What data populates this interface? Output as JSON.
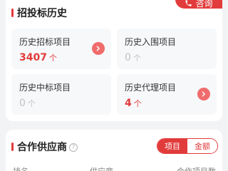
{
  "colors": {
    "accent": "#e23b3b",
    "muted": "#c2c2c2"
  },
  "consult": {
    "label": "咨询",
    "icon": "phone-icon"
  },
  "bidding_history": {
    "title": "招投标历史",
    "stats": [
      {
        "label": "历史招标项目",
        "value": "3407",
        "unit": "个",
        "highlighted": true,
        "has_arrow": true
      },
      {
        "label": "历史入围项目",
        "value": "0",
        "unit": "个",
        "highlighted": false,
        "has_arrow": false
      },
      {
        "label": "历史中标项目",
        "value": "0",
        "unit": "个",
        "highlighted": false,
        "has_arrow": false
      },
      {
        "label": "历史代理项目",
        "value": "4",
        "unit": "个",
        "highlighted": true,
        "has_arrow": true
      }
    ]
  },
  "partners": {
    "title": "合作供应商",
    "help_icon": "question-icon",
    "toggle": {
      "project": "项目",
      "amount": "金额",
      "selected": "project"
    },
    "columns": [
      "排名",
      "供应商",
      "合作项目数"
    ]
  }
}
